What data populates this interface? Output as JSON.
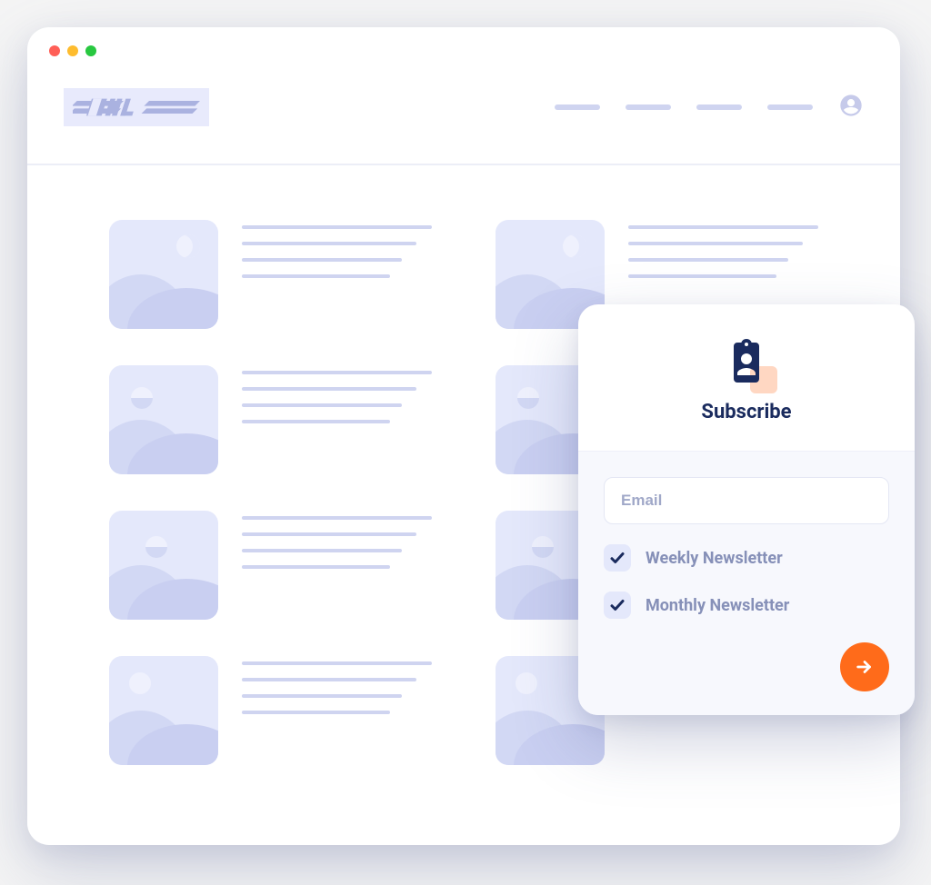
{
  "brand": {
    "name": "DHL"
  },
  "subscribe": {
    "title": "Subscribe",
    "email_placeholder": "Email",
    "options": {
      "weekly": {
        "label": "Weekly Newsletter",
        "checked": true
      },
      "monthly": {
        "label": "Monthly Newsletter",
        "checked": true
      }
    }
  }
}
